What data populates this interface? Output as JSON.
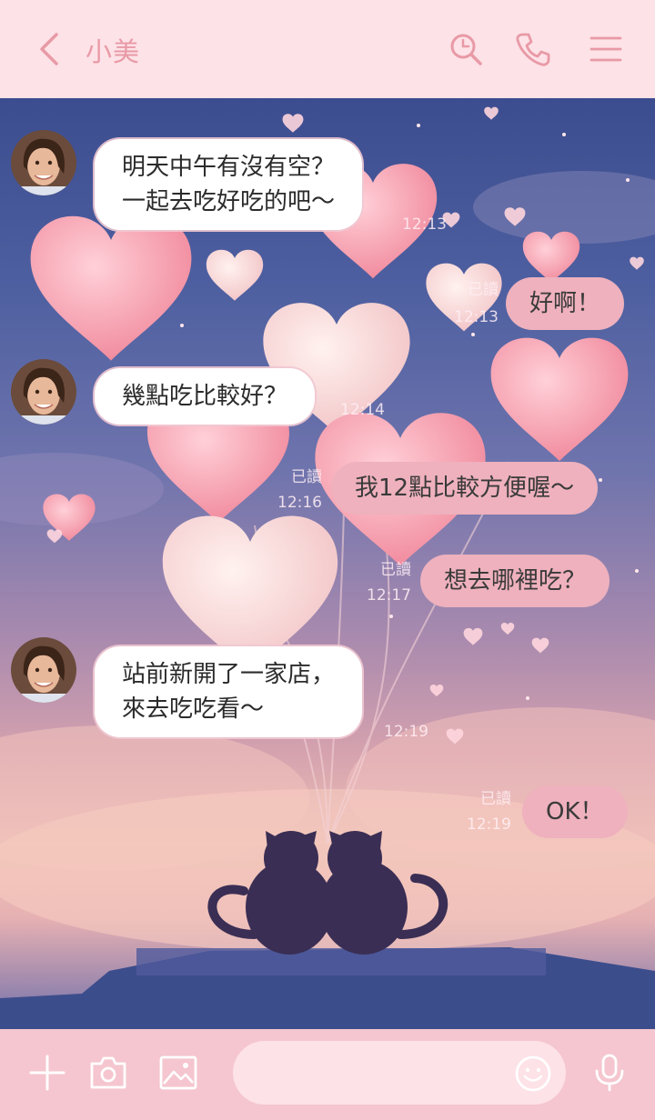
{
  "header": {
    "title": "小美",
    "icons": [
      "chevron-left-icon",
      "search-icon",
      "phone-icon",
      "menu-icon"
    ]
  },
  "messages": [
    {
      "side": "in",
      "lines": [
        "明天中午有沒有空？",
        "一起去吃好吃的吧～"
      ],
      "time": "12:13"
    },
    {
      "side": "out",
      "text": "好啊！",
      "read": "已讀",
      "time": "12:13"
    },
    {
      "side": "in",
      "text": "幾點吃比較好？",
      "time": "12:14"
    },
    {
      "side": "out",
      "text": "我12點比較方便喔～",
      "read": "已讀",
      "time": "12:16"
    },
    {
      "side": "out",
      "text": "想去哪裡吃？",
      "read": "已讀",
      "time": "12:17"
    },
    {
      "side": "in",
      "lines": [
        "站前新開了一家店，",
        "來去吃吃看～"
      ],
      "time": "12:19"
    },
    {
      "side": "out",
      "text": "OK！",
      "read": "已讀",
      "time": "12:19"
    }
  ],
  "bottom_bar": {
    "icons": [
      "plus-icon",
      "camera-icon",
      "image-icon",
      "emoji-icon",
      "microphone-icon"
    ],
    "input_value": ""
  },
  "colors": {
    "header_bg": "#fde2e7",
    "accent": "#e89aa6",
    "out_bubble": "#eeb1bd",
    "in_bubble": "#ffffff",
    "bottom_bg": "#f5c6cf"
  }
}
